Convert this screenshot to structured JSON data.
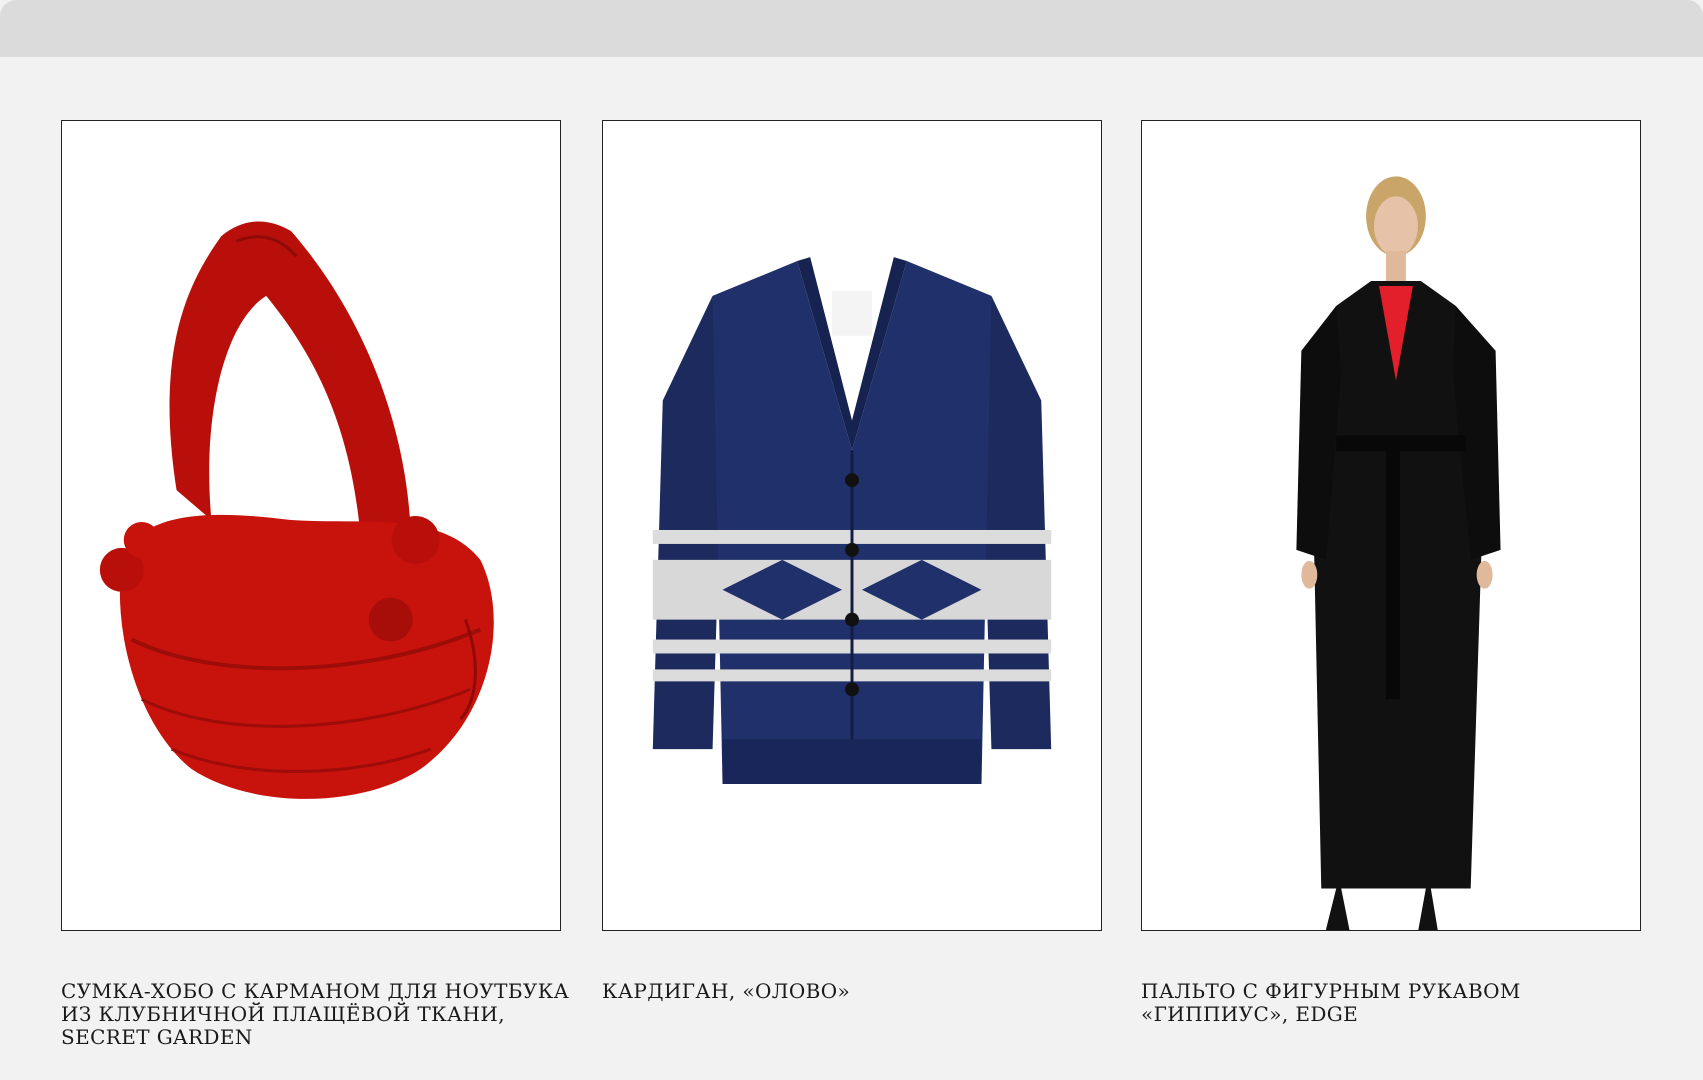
{
  "products": [
    {
      "image_icon": "red-hobo-bag-image",
      "caption_lines": [
        "Сумка-хобо с карманом для ноутбука",
        "из клубничной плащёвой ткани,",
        "Secret Garden"
      ]
    },
    {
      "image_icon": "navy-knit-cardigan-image",
      "caption_lines": [
        "Кардиган, «ОЛОВО»"
      ]
    },
    {
      "image_icon": "black-long-coat-model-image",
      "caption_lines": [
        "Пальто с фигурным рукавом",
        "«ГИППИУС», EDGE"
      ]
    }
  ],
  "colors": {
    "background": "#f2f2f2",
    "topbar": "#dbdbdb",
    "bag_red": "#c8120c",
    "cardigan_navy": "#1c2a5e",
    "coat_black": "#111111",
    "coat_lining_red": "#e21f2b"
  }
}
